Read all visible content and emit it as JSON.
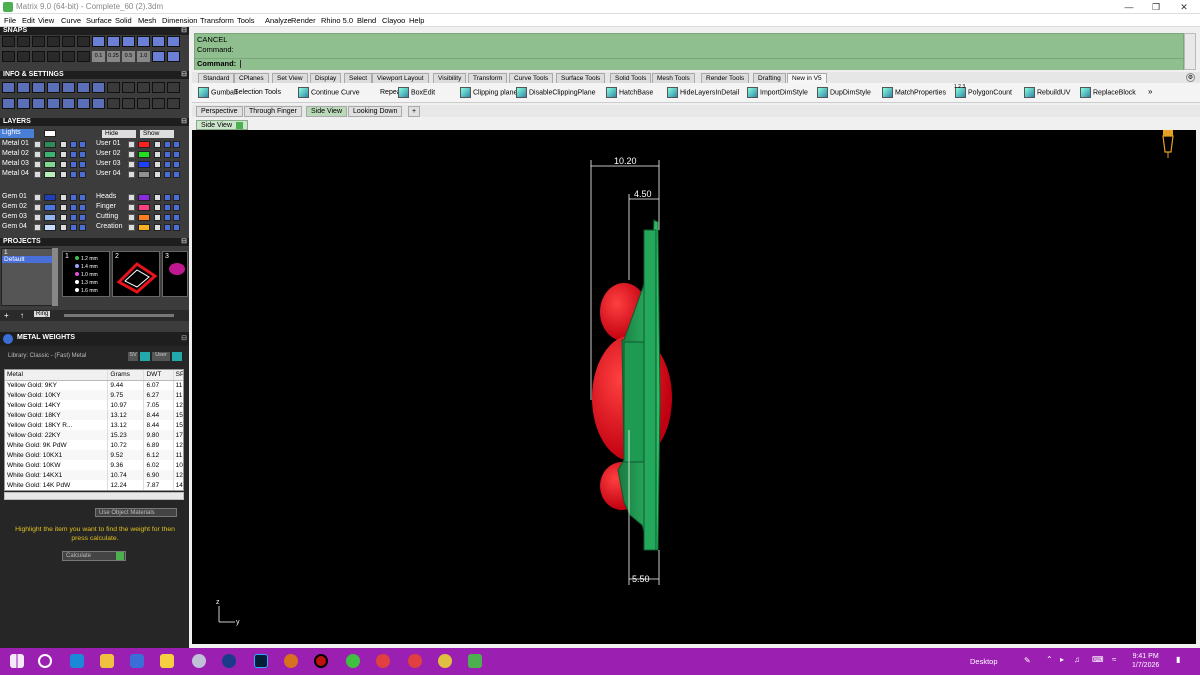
{
  "window": {
    "title": "Matrix 9.0 (64-bit) - Complete_60 (2).3dm"
  },
  "menu": [
    "File",
    "Edit",
    "View",
    "Curve",
    "Surface",
    "Solid",
    "Mesh",
    "Dimension",
    "Transform",
    "Tools",
    "Analyze",
    "Render",
    "Rhino 5.0",
    "Blend",
    "Clayoo",
    "Help"
  ],
  "panels": {
    "snaps": "SNAPS",
    "info": "INFO & SETTINGS",
    "snap_values": [
      "0.1",
      "0.25",
      "0.5",
      "1.0"
    ],
    "layers": "LAYERS",
    "projects": "PROJECTS",
    "metal_weights": "METAL WEIGHTS"
  },
  "layers": {
    "lights": "Lights",
    "hide": "Hide",
    "show": "Show",
    "rows": [
      {
        "name": "Metal 01",
        "color": "#2e8b57"
      },
      {
        "name": "Metal 02",
        "color": "#3cb371"
      },
      {
        "name": "Metal 03",
        "color": "#7fd88f"
      },
      {
        "name": "Metal 04",
        "color": "#b8f0b8"
      },
      {
        "name": "Gem 01",
        "color": "#1f3fb8"
      },
      {
        "name": "Gem 02",
        "color": "#4a78e0"
      },
      {
        "name": "Gem 03",
        "color": "#8fb4f0"
      },
      {
        "name": "Gem 04",
        "color": "#c8dcff"
      }
    ],
    "rows_right": [
      {
        "name": "User 01",
        "color": "#ff2020"
      },
      {
        "name": "User 02",
        "color": "#20e020"
      },
      {
        "name": "User 03",
        "color": "#2040ff"
      },
      {
        "name": "User 04",
        "color": "#909090"
      },
      {
        "name": "Heads",
        "color": "#8a2be2"
      },
      {
        "name": "Finger",
        "color": "#ff4080"
      },
      {
        "name": "Cutting",
        "color": "#ff7f20"
      },
      {
        "name": "Creation",
        "color": "#ffb020"
      }
    ]
  },
  "projects": {
    "list_num": "1",
    "list_item": "Default",
    "thumb_numbers": [
      "1",
      "2",
      "3"
    ],
    "thumb1_sizes": [
      "1.2 mm",
      "1.4 mm",
      "1.0 mm",
      "1.3 mm",
      "1.6 mm"
    ],
    "ring_label": "Ring"
  },
  "metal_weights": {
    "library": "Library: Classic - (Fast) Metal",
    "sv_label": "SV",
    "user_label": "User",
    "columns": [
      "Metal",
      "Grams",
      "DWT",
      "SPG"
    ],
    "rows": [
      [
        "Yellow Gold: 9KY",
        "9.44",
        "6.07",
        "11.08"
      ],
      [
        "Yellow Gold: 10KY",
        "9.75",
        "6.27",
        "11.45"
      ],
      [
        "Yellow Gold: 14KY",
        "10.97",
        "7.05",
        "12.88"
      ],
      [
        "Yellow Gold: 18KY",
        "13.12",
        "8.44",
        "15.41"
      ],
      [
        "Yellow Gold: 18KY R...",
        "13.12",
        "8.44",
        "15.41"
      ],
      [
        "Yellow Gold: 22KY",
        "15.23",
        "9.80",
        "17.89"
      ],
      [
        "White Gold: 9K PdW",
        "10.72",
        "6.89",
        "12.59"
      ],
      [
        "White Gold: 10KX1",
        "9.52",
        "6.12",
        "11.18"
      ],
      [
        "White Gold: 10KW",
        "9.36",
        "6.02",
        "10.99"
      ],
      [
        "White Gold: 14KX1",
        "10.74",
        "6.90",
        "12.61"
      ],
      [
        "White Gold: 14K PdW",
        "12.24",
        "7.87",
        "14.37"
      ]
    ],
    "use_object_materials": "Use Object Materials",
    "hint": "Highlight the item you want to find the weight for then press calculate.",
    "calc": "Calculate"
  },
  "command": {
    "line1": "CANCEL",
    "line2": "Command:",
    "prompt": "Command:"
  },
  "toolbar_tabs": [
    "Standard",
    "CPlanes",
    "Set View",
    "Display",
    "Select",
    "Viewport Layout",
    "Visibility",
    "Transform",
    "Curve Tools",
    "Surface Tools",
    "Solid Tools",
    "Mesh Tools",
    "Render Tools",
    "Drafting",
    "New in V5"
  ],
  "tools": [
    "Gumball",
    "Selection Tools",
    "Continue Curve",
    "Repeat",
    "BoxEdit",
    "Clipping plane",
    "DisableClippingPlane",
    "HatchBase",
    "HideLayersInDetail",
    "ImportDimStyle",
    "DupDimStyle",
    "MatchProperties",
    "PolygonCount",
    "RebuildUV",
    "ReplaceBlock"
  ],
  "polygon_count_badge": "1 2 3",
  "viewport_tabs": [
    "Perspective",
    "Through Finger",
    "Side View",
    "Looking Down"
  ],
  "active_viewport": "Side View",
  "dimensions": {
    "d1": "10.20",
    "d2": "4.50",
    "d3": "5.50"
  },
  "axis": {
    "z": "z",
    "y": "y"
  },
  "taskbar": {
    "desktop": "Desktop",
    "time": "9:41 PM",
    "date": "1/7/2026"
  },
  "colors": {
    "command_bg": "#8fbe8f",
    "taskbar": "#9b1fb0",
    "viewport": "#000000",
    "gem_red": "#e8141b",
    "metal_green": "#1f8a4c"
  }
}
